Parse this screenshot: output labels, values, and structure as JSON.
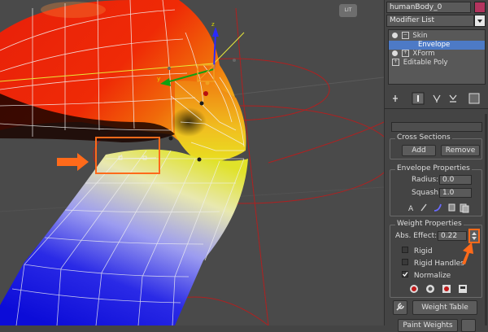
{
  "viewport": {
    "label": "LIT"
  },
  "panel": {
    "object_name": "humanBody_0",
    "name_color": "#b3345e",
    "modifier_list": "Modifier List",
    "stack": [
      {
        "label": "Skin",
        "selected": false,
        "indent": 0
      },
      {
        "label": "Envelope",
        "selected": true,
        "indent": 1
      },
      {
        "label": "XForm",
        "selected": false,
        "indent": 0
      },
      {
        "label": "Editable Poly",
        "selected": false,
        "indent": 0
      }
    ],
    "cross_sections": {
      "title": "Cross Sections",
      "add": "Add",
      "remove": "Remove"
    },
    "envelope_properties": {
      "title": "Envelope Properties",
      "radius_label": "Radius:",
      "radius_value": "0.0",
      "squash_label": "Squash:",
      "squash_value": "1.0"
    },
    "weight_properties": {
      "title": "Weight Properties",
      "abs_effect_label": "Abs. Effect:",
      "abs_effect_value": "0.22",
      "rigid": "Rigid",
      "rigid_handles": "Rigid Handles",
      "normalize": "Normalize",
      "weight_table": "Weight Table",
      "paint_weights": "Paint Weights"
    },
    "highlight_color": "#ff6a1a"
  }
}
